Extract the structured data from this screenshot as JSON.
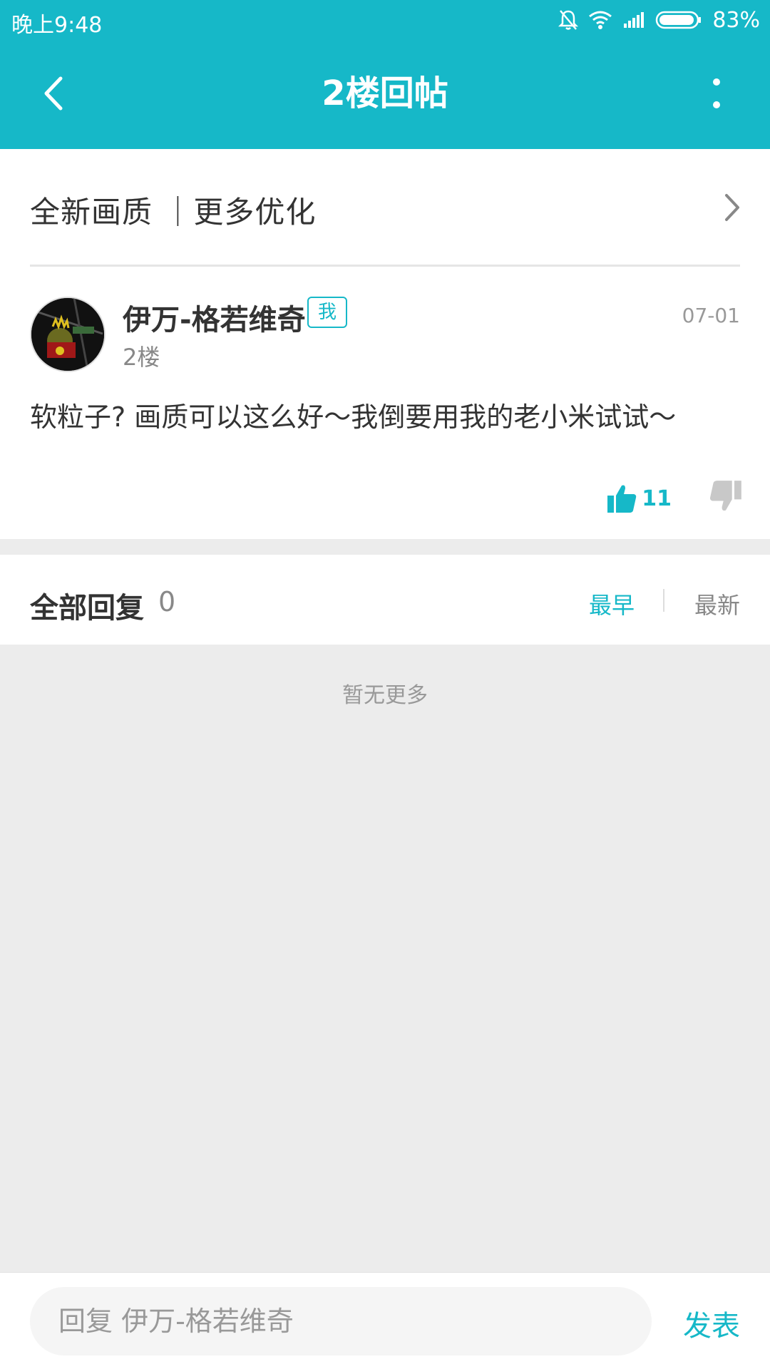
{
  "status_bar": {
    "time": "晚上9:48",
    "battery_percent": "83%",
    "icons": [
      "mute-icon",
      "wifi-icon",
      "signal-icon",
      "battery-icon"
    ]
  },
  "app_bar": {
    "title": "2楼回帖",
    "back_icon": "chevron-left-icon",
    "more_icon": "more-vertical-icon"
  },
  "promo": {
    "text": "全新画质 ｜更多优化"
  },
  "post": {
    "author": "伊万-格若维奇",
    "me_badge": "我",
    "floor": "2楼",
    "date": "07-01",
    "content": "软粒子? 画质可以这么好～我倒要用我的老小米试试～",
    "like_count": "11"
  },
  "replies": {
    "title": "全部回复",
    "count": "0",
    "sort_earliest": "最早",
    "sort_latest": "最新",
    "empty_text": "暂无更多"
  },
  "reply_bar": {
    "placeholder": "回复 伊万-格若维奇",
    "send_label": "发表"
  },
  "colors": {
    "accent": "#16b8c8",
    "background": "#ececec"
  }
}
